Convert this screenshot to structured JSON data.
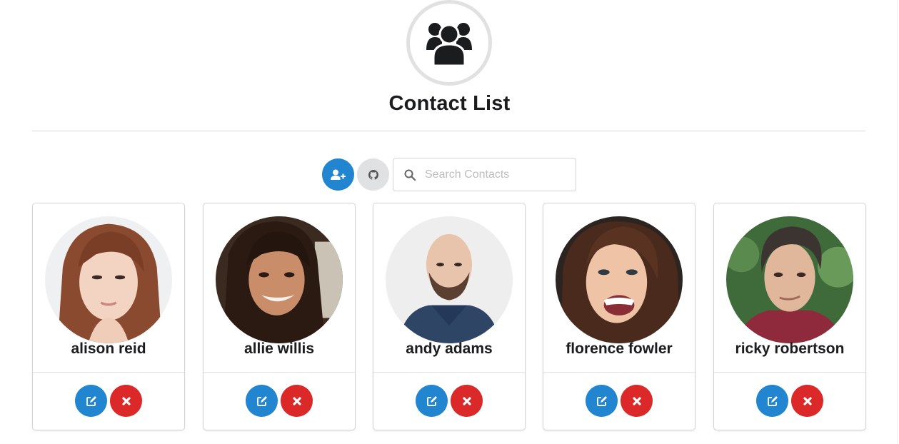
{
  "header": {
    "icon": "users-icon",
    "title": "Contact List"
  },
  "toolbar": {
    "add_contact_icon": "user-plus-icon",
    "github_icon": "github-icon",
    "search": {
      "icon": "search-icon",
      "placeholder": "Search Contacts",
      "value": ""
    }
  },
  "colors": {
    "primary": "#2185d0",
    "danger": "#db2828",
    "neutral": "#e0e1e2",
    "text": "#1b1c1d"
  },
  "contacts": [
    {
      "name": "alison reid",
      "edit_icon": "edit-icon",
      "delete_icon": "close-icon"
    },
    {
      "name": "allie willis",
      "edit_icon": "edit-icon",
      "delete_icon": "close-icon"
    },
    {
      "name": "andy adams",
      "edit_icon": "edit-icon",
      "delete_icon": "close-icon"
    },
    {
      "name": "florence fowler",
      "edit_icon": "edit-icon",
      "delete_icon": "close-icon"
    },
    {
      "name": "ricky robertson",
      "edit_icon": "edit-icon",
      "delete_icon": "close-icon"
    }
  ]
}
